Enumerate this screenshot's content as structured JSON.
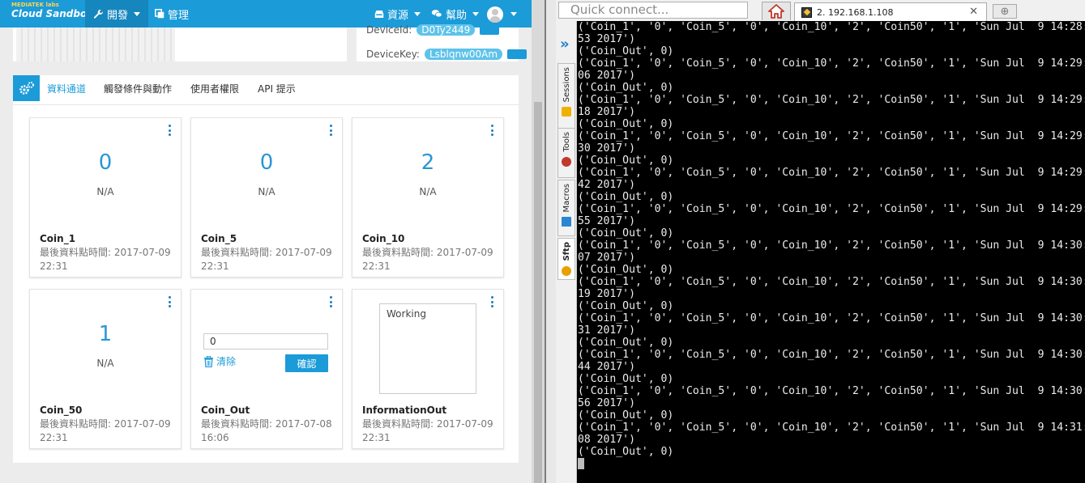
{
  "topbar": {
    "logo_line1": "MEDIATEK labs",
    "logo_line2": "Cloud Sandbox",
    "develop_label": "開發",
    "manage_label": "管理",
    "resources_label": "資源",
    "help_label": "幫助"
  },
  "device": {
    "deviceid_label": "DeviceId:",
    "deviceid_value": "D0Ty2449",
    "devicekey_label": "DeviceKey:",
    "devicekey_value": "Lsblqnw00Am"
  },
  "tabs": [
    "資料通道",
    "觸發條件與動作",
    "使用者權限",
    "API 提示"
  ],
  "cards": [
    {
      "value": "0",
      "unit": "N/A",
      "name": "Coin_1",
      "time_label": "最後資料點時間: 2017-07-09 22:31"
    },
    {
      "value": "0",
      "unit": "N/A",
      "name": "Coin_5",
      "time_label": "最後資料點時間: 2017-07-09 22:31"
    },
    {
      "value": "2",
      "unit": "N/A",
      "name": "Coin_10",
      "time_label": "最後資料點時間: 2017-07-09 22:31"
    },
    {
      "value": "1",
      "unit": "N/A",
      "name": "Coin_50",
      "time_label": "最後資料點時間: 2017-07-09 22:31"
    },
    {
      "input_value": "0",
      "clear_label": "清除",
      "confirm_label": "確認",
      "name": "Coin_Out",
      "time_label": "最後資料點時間: 2017-07-08 16:06"
    },
    {
      "text_value": "Working",
      "name": "InformationOut",
      "time_label": "最後資料點時間: 2017-07-09 22:31"
    }
  ],
  "terminal_app": {
    "quick_connect_placeholder": "Quick connect...",
    "tab_title": "2. 192.168.1.108",
    "side_tabs": [
      "Sessions",
      "Tools",
      "Macros",
      "Sftp"
    ]
  },
  "terminal": {
    "lines": [
      "('Coin_1', '0', 'Coin_5', '0', 'Coin_10', '2', 'Coin50', '1', 'Sun Jul  9 14:28:",
      "53 2017')",
      "('Coin_Out', 0)",
      "('Coin_1', '0', 'Coin_5', '0', 'Coin_10', '2', 'Coin50', '1', 'Sun Jul  9 14:29:",
      "06 2017')",
      "('Coin_Out', 0)",
      "('Coin_1', '0', 'Coin_5', '0', 'Coin_10', '2', 'Coin50', '1', 'Sun Jul  9 14:29:",
      "18 2017')",
      "('Coin_Out', 0)",
      "('Coin_1', '0', 'Coin_5', '0', 'Coin_10', '2', 'Coin50', '1', 'Sun Jul  9 14:29:",
      "30 2017')",
      "('Coin_Out', 0)",
      "('Coin_1', '0', 'Coin_5', '0', 'Coin_10', '2', 'Coin50', '1', 'Sun Jul  9 14:29:",
      "42 2017')",
      "('Coin_Out', 0)",
      "('Coin_1', '0', 'Coin_5', '0', 'Coin_10', '2', 'Coin50', '1', 'Sun Jul  9 14:29:",
      "55 2017')",
      "('Coin_Out', 0)",
      "('Coin_1', '0', 'Coin_5', '0', 'Coin_10', '2', 'Coin50', '1', 'Sun Jul  9 14:30:",
      "07 2017')",
      "('Coin_Out', 0)",
      "('Coin_1', '0', 'Coin_5', '0', 'Coin_10', '2', 'Coin50', '1', 'Sun Jul  9 14:30:",
      "19 2017')",
      "('Coin_Out', 0)",
      "('Coin_1', '0', 'Coin_5', '0', 'Coin_10', '2', 'Coin50', '1', 'Sun Jul  9 14:30:",
      "31 2017')",
      "('Coin_Out', 0)",
      "('Coin_1', '0', 'Coin_5', '0', 'Coin_10', '2', 'Coin50', '1', 'Sun Jul  9 14:30:",
      "44 2017')",
      "('Coin_Out', 0)",
      "('Coin_1', '0', 'Coin_5', '0', 'Coin_10', '2', 'Coin50', '1', 'Sun Jul  9 14:30:",
      "56 2017')",
      "('Coin_Out', 0)",
      "('Coin_1', '0', 'Coin_5', '0', 'Coin_10', '2', 'Coin50', '1', 'Sun Jul  9 14:31:",
      "08 2017')",
      "('Coin_Out', 0)"
    ]
  },
  "icons": {
    "develop": "wrench-icon",
    "manage": "copy-icon",
    "resources": "inbox-icon",
    "help": "chat-icon",
    "account": "user-avatar-icon",
    "channels_tab": "gears-icon",
    "card_menu": "kebab-menu-icon",
    "clear": "trash-icon",
    "collapse_sidebar": "double-chevron-icon",
    "home_tab": "home-icon"
  },
  "colors": {
    "accent": "#1b9bd8",
    "terminal_bg": "#000000",
    "terminal_fg": "#ececec"
  }
}
